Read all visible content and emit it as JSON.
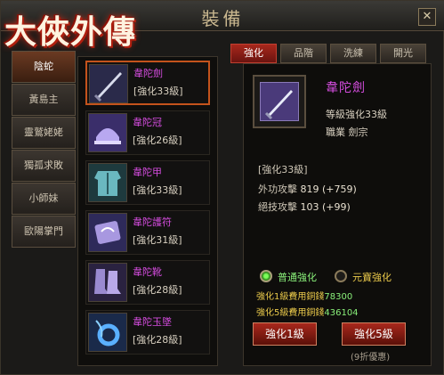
{
  "window": {
    "title": "裝備",
    "close_label": "✕"
  },
  "logo": {
    "text": "大俠外傳"
  },
  "characters": [
    {
      "label": "陰蛇",
      "active": true
    },
    {
      "label": "黃島主",
      "active": false
    },
    {
      "label": "靈鷲姥姥",
      "active": false
    },
    {
      "label": "獨孤求敗",
      "active": false
    },
    {
      "label": "小師妹",
      "active": false
    },
    {
      "label": "歐陽掌門",
      "active": false
    }
  ],
  "equipment": [
    {
      "name": "韋陀劍",
      "level": "[強化33級]",
      "icon": "sword-icon",
      "selected": true
    },
    {
      "name": "韋陀冠",
      "level": "[強化26級]",
      "icon": "helmet-icon",
      "selected": false
    },
    {
      "name": "韋陀甲",
      "level": "[強化33級]",
      "icon": "armor-icon",
      "selected": false
    },
    {
      "name": "韋陀護符",
      "level": "[強化31級]",
      "icon": "amulet-icon",
      "selected": false
    },
    {
      "name": "韋陀靴",
      "level": "[強化28級]",
      "icon": "boots-icon",
      "selected": false
    },
    {
      "name": "韋陀玉墜",
      "level": "[強化28級]",
      "icon": "pendant-icon",
      "selected": false
    }
  ],
  "tabs": [
    {
      "label": "強化",
      "active": true
    },
    {
      "label": "品階",
      "active": false
    },
    {
      "label": "洗練",
      "active": false
    },
    {
      "label": "開光",
      "active": false
    }
  ],
  "detail": {
    "name": "韋陀劍",
    "level_line": "等級強化33級",
    "job_line": "職業 劍宗",
    "enhance_level": "[強化33級]",
    "stats": [
      {
        "label": "外功攻擊",
        "value": "819",
        "bonus": "(+759)"
      },
      {
        "label": "絕技攻擊",
        "value": "103",
        "bonus": "(+99)"
      }
    ]
  },
  "options": {
    "normal": {
      "label": "普通強化",
      "selected": true
    },
    "gold": {
      "label": "元寶強化",
      "selected": false
    }
  },
  "costs": [
    {
      "prefix": "強化1級費用銅錢",
      "currency": "銅錢",
      "amount": "78300"
    },
    {
      "prefix": "強化5級費用銅錢",
      "currency": "銅錢",
      "amount": "436104"
    }
  ],
  "buttons": {
    "enhance1": "強化1級",
    "enhance5": "強化5級",
    "discount": "(9折優惠)"
  },
  "colors": {
    "item_name": "#d64de0",
    "accent_red": "#a8281c",
    "gold_text": "#e8c84a",
    "green_text": "#8af07a"
  }
}
